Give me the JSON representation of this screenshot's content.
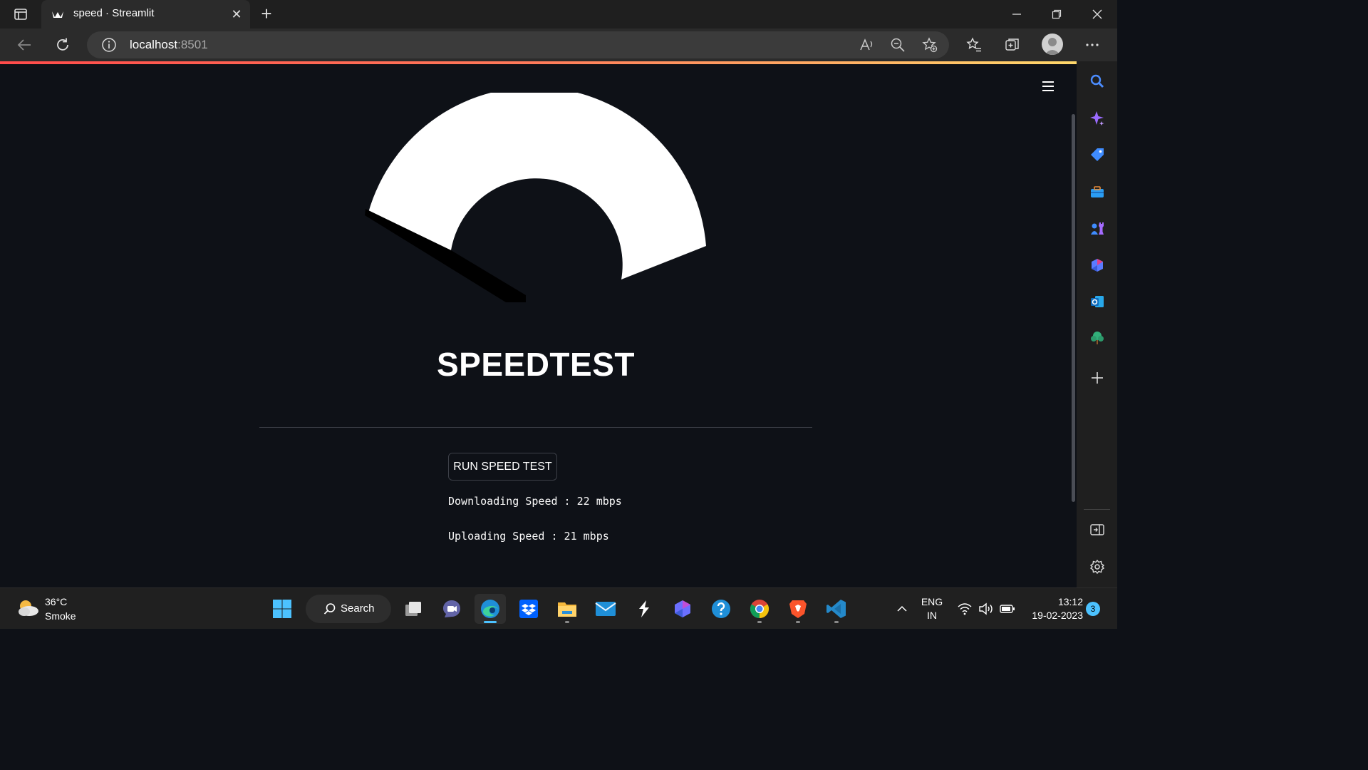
{
  "browser": {
    "tab": {
      "title": "speed · Streamlit"
    },
    "address": {
      "host": "localhost",
      "port": ":8501"
    }
  },
  "page": {
    "title": "SPEEDTEST",
    "run_button_label": "RUN SPEED TEST",
    "download_text": "Downloading Speed : 22 mbps",
    "upload_text": "Uploading Speed : 21 mbps"
  },
  "taskbar": {
    "weather_temp": "36°C",
    "weather_desc": "Smoke",
    "search_label": "Search",
    "lang_top": "ENG",
    "lang_bottom": "IN",
    "time": "13:12",
    "date": "19-02-2023",
    "notifications": "3"
  },
  "colors": {
    "page_bg": "#0e1117",
    "accent_gradient_start": "#ff4b4b",
    "accent_gradient_end": "#ffd86b",
    "taskbar_active": "#4cc2ff"
  }
}
